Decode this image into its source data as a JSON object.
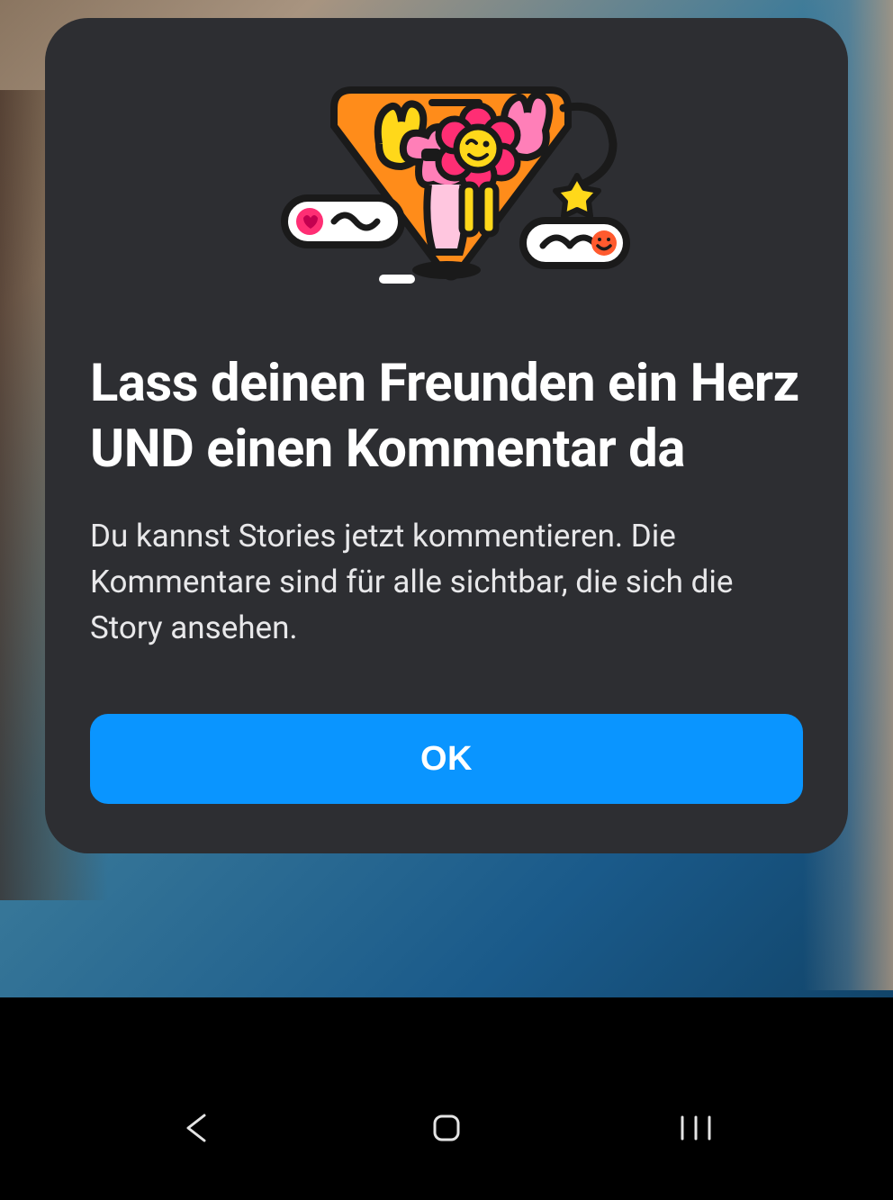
{
  "dialog": {
    "title": "Lass deinen Freunden ein Herz UND einen Kommentar da",
    "body": "Du kannst Stories jetzt kommentieren. Die Kommentare sind für alle sichtbar, die sich die Story ansehen.",
    "ok_label": "OK"
  },
  "nav": {
    "back": "back",
    "home": "home",
    "recents": "recents"
  },
  "illustration": {
    "semantic": "cartoon-characters-peace-signs-with-reaction-pills"
  }
}
